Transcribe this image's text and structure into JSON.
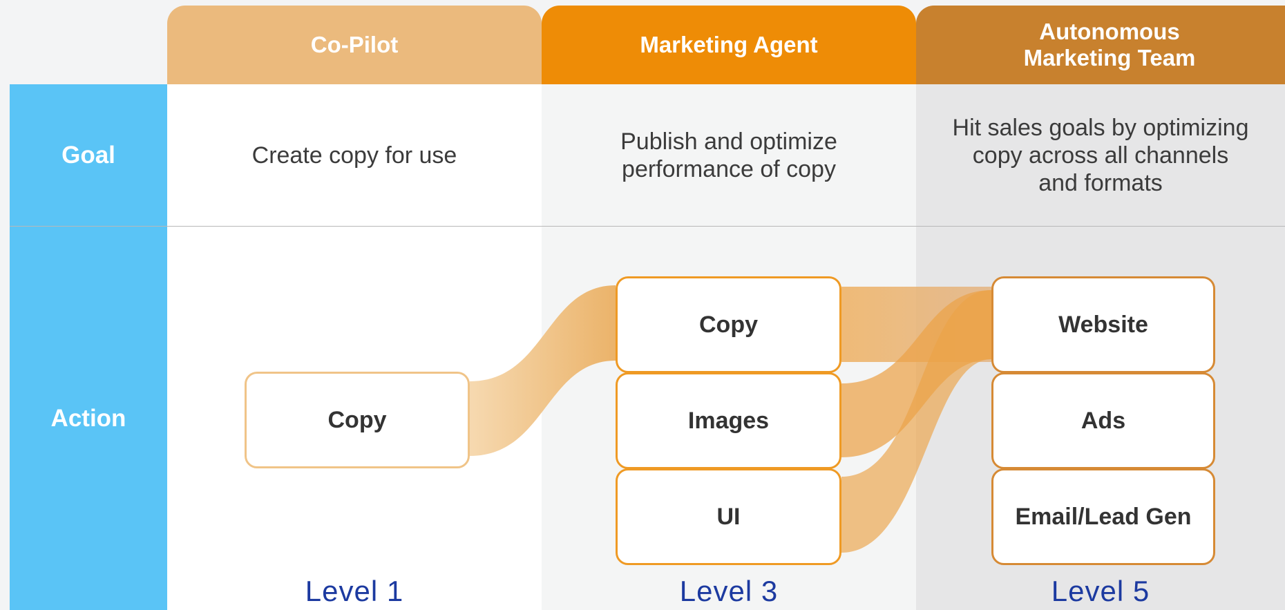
{
  "headers": {
    "copilot": "Co-Pilot",
    "agent": "Marketing Agent",
    "team": "Autonomous\nMarketing Team"
  },
  "rows": {
    "goal": "Goal",
    "action": "Action"
  },
  "goals": {
    "level1": "Create copy for use",
    "level3": "Publish and optimize\nperformance of copy",
    "level5": "Hit sales goals by optimizing\ncopy across all channels\nand formats"
  },
  "actions": {
    "level1": [
      "Copy"
    ],
    "level3": [
      "Copy",
      "Images",
      "UI"
    ],
    "level5": [
      "Website",
      "Ads",
      "Email/Lead Gen"
    ]
  },
  "levels": {
    "level1": "Level 1",
    "level3": "Level 3",
    "level5": "Level 5"
  },
  "colors": {
    "goal_action_label_bg": "#5ac4f6",
    "copilot_header": "#ebba7d",
    "agent_header": "#ee8c06",
    "team_header": "#c8812e",
    "level_text": "#1c3aa0",
    "flow": "#eda240"
  }
}
